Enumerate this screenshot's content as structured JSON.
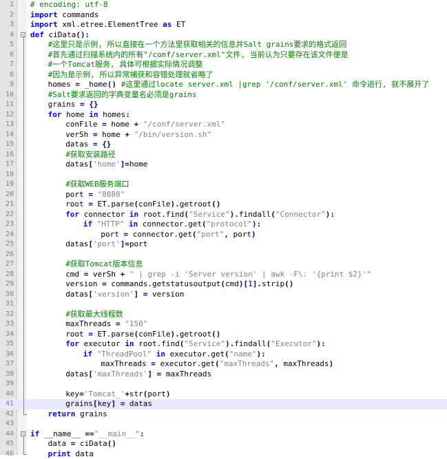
{
  "colors": {
    "keyword": "#0000ff",
    "comment": "#008000",
    "string": "#808080",
    "operator": "#000080",
    "gutter": "#e4e4e4",
    "current_line": "#e8e8ff"
  },
  "lines": [
    {
      "no": "1",
      "indent": 0,
      "tokens": [
        [
          "cm",
          "# encoding: utf-8"
        ]
      ]
    },
    {
      "no": "2",
      "indent": 0,
      "tokens": [
        [
          "kw",
          "import"
        ],
        [
          "nm",
          " commands"
        ]
      ]
    },
    {
      "no": "3",
      "indent": 0,
      "tokens": [
        [
          "kw",
          "import"
        ],
        [
          "nm",
          " xml.etree.ElementTree "
        ],
        [
          "kw",
          "as"
        ],
        [
          "nm",
          " ET"
        ]
      ]
    },
    {
      "no": "4",
      "indent": 0,
      "tokens": [
        [
          "kw",
          "def"
        ],
        [
          "nm",
          " ciData"
        ],
        [
          "op",
          "():"
        ]
      ]
    },
    {
      "no": "5",
      "indent": 1,
      "tokens": [
        [
          "cm",
          "#这里只是示例, 所以直接在一个方法里获取相关的信息并Salt grains要求的格式返回"
        ]
      ]
    },
    {
      "no": "6",
      "indent": 1,
      "tokens": [
        [
          "cm",
          "#首先通过扫描系统内的所有\"/conf/server.xml\"文件, 当前认为只要存在该文件便是"
        ]
      ]
    },
    {
      "no": "7",
      "indent": 1,
      "tokens": [
        [
          "cm",
          "#一个Tomcat服务, 具体可根据实际情况调整"
        ]
      ]
    },
    {
      "no": "8",
      "indent": 1,
      "tokens": [
        [
          "cm",
          "#因为是示例, 所以异常捕获和容错处理就省略了"
        ]
      ]
    },
    {
      "no": "9",
      "indent": 1,
      "tokens": [
        [
          "nm",
          "homes "
        ],
        [
          "op",
          "="
        ],
        [
          "nm",
          " _home"
        ],
        [
          "op",
          "()"
        ],
        [
          "nm",
          " "
        ],
        [
          "cm",
          "#这里通过locate server.xml |grep '/conf/server.xml' 命令进行, 就不展开了"
        ]
      ]
    },
    {
      "no": "10",
      "indent": 1,
      "tokens": [
        [
          "cm",
          "#Salt要求返回的字典变量名必须是grains"
        ]
      ]
    },
    {
      "no": "11",
      "indent": 1,
      "tokens": [
        [
          "nm",
          "grains "
        ],
        [
          "op",
          "="
        ],
        [
          "nm",
          " "
        ],
        [
          "op",
          "{}"
        ]
      ]
    },
    {
      "no": "12",
      "indent": 1,
      "tokens": [
        [
          "kw",
          "for"
        ],
        [
          "nm",
          " home "
        ],
        [
          "kw",
          "in"
        ],
        [
          "nm",
          " homes"
        ],
        [
          "op",
          ":"
        ]
      ]
    },
    {
      "no": "13",
      "indent": 2,
      "tokens": [
        [
          "nm",
          "conFile "
        ],
        [
          "op",
          "="
        ],
        [
          "nm",
          " home "
        ],
        [
          "op",
          "+"
        ],
        [
          "nm",
          " "
        ],
        [
          "st",
          "\"/conf/server.xml\""
        ]
      ]
    },
    {
      "no": "14",
      "indent": 2,
      "tokens": [
        [
          "nm",
          "verSh "
        ],
        [
          "op",
          "="
        ],
        [
          "nm",
          " home "
        ],
        [
          "op",
          "+"
        ],
        [
          "nm",
          " "
        ],
        [
          "st",
          "\"/bin/version.sh\""
        ]
      ]
    },
    {
      "no": "15",
      "indent": 2,
      "tokens": [
        [
          "nm",
          "datas "
        ],
        [
          "op",
          "="
        ],
        [
          "nm",
          " "
        ],
        [
          "op",
          "{}"
        ]
      ]
    },
    {
      "no": "16",
      "indent": 2,
      "tokens": [
        [
          "cm",
          "#获取安装路径"
        ]
      ]
    },
    {
      "no": "17",
      "indent": 2,
      "tokens": [
        [
          "nm",
          "datas"
        ],
        [
          "op",
          "["
        ],
        [
          "st",
          "'home'"
        ],
        [
          "op",
          "]="
        ],
        [
          "nm",
          "home"
        ]
      ]
    },
    {
      "no": "18",
      "indent": 0,
      "tokens": []
    },
    {
      "no": "19",
      "indent": 2,
      "tokens": [
        [
          "cm",
          "#获取WEB服务端口"
        ]
      ]
    },
    {
      "no": "20",
      "indent": 2,
      "tokens": [
        [
          "nm",
          "port "
        ],
        [
          "op",
          "="
        ],
        [
          "nm",
          " "
        ],
        [
          "st",
          "\"8080\""
        ]
      ]
    },
    {
      "no": "21",
      "indent": 2,
      "tokens": [
        [
          "nm",
          "root "
        ],
        [
          "op",
          "="
        ],
        [
          "nm",
          " ET.parse"
        ],
        [
          "op",
          "("
        ],
        [
          "nm",
          "conFile"
        ],
        [
          "op",
          ")."
        ],
        [
          "nm",
          "getroot"
        ],
        [
          "op",
          "()"
        ]
      ]
    },
    {
      "no": "22",
      "indent": 2,
      "tokens": [
        [
          "kw",
          "for"
        ],
        [
          "nm",
          " connector "
        ],
        [
          "kw",
          "in"
        ],
        [
          "nm",
          " root.find"
        ],
        [
          "op",
          "("
        ],
        [
          "st",
          "\"Service\""
        ],
        [
          "op",
          ")."
        ],
        [
          "nm",
          "findall"
        ],
        [
          "op",
          "("
        ],
        [
          "st",
          "\"Connector\""
        ],
        [
          "op",
          "):"
        ]
      ]
    },
    {
      "no": "23",
      "indent": 3,
      "tokens": [
        [
          "kw",
          "if"
        ],
        [
          "nm",
          " "
        ],
        [
          "st",
          "\"HTTP\""
        ],
        [
          "nm",
          " "
        ],
        [
          "kw",
          "in"
        ],
        [
          "nm",
          " connector.get"
        ],
        [
          "op",
          "("
        ],
        [
          "st",
          "\"protocol\""
        ],
        [
          "op",
          "):"
        ]
      ]
    },
    {
      "no": "24",
      "indent": 4,
      "tokens": [
        [
          "nm",
          "port "
        ],
        [
          "op",
          "="
        ],
        [
          "nm",
          " connector.get"
        ],
        [
          "op",
          "("
        ],
        [
          "st",
          "\"port\""
        ],
        [
          "op",
          ","
        ],
        [
          "nm",
          " port"
        ],
        [
          "op",
          ")"
        ]
      ]
    },
    {
      "no": "25",
      "indent": 2,
      "tokens": [
        [
          "nm",
          "datas"
        ],
        [
          "op",
          "["
        ],
        [
          "st",
          "'port'"
        ],
        [
          "op",
          "]="
        ],
        [
          "nm",
          "port"
        ]
      ]
    },
    {
      "no": "26",
      "indent": 0,
      "tokens": []
    },
    {
      "no": "27",
      "indent": 2,
      "tokens": [
        [
          "cm",
          "#获取Tomcat版本信息"
        ]
      ]
    },
    {
      "no": "28",
      "indent": 2,
      "tokens": [
        [
          "nm",
          "cmd "
        ],
        [
          "op",
          "="
        ],
        [
          "nm",
          " verSh "
        ],
        [
          "op",
          "+"
        ],
        [
          "nm",
          " "
        ],
        [
          "st",
          "\" | grep -i 'Server version' | awk -F\\: '{print $2}'\""
        ]
      ]
    },
    {
      "no": "29",
      "indent": 2,
      "tokens": [
        [
          "nm",
          "version "
        ],
        [
          "op",
          "="
        ],
        [
          "nm",
          " commands.getstatusoutput"
        ],
        [
          "op",
          "("
        ],
        [
          "nm",
          "cmd"
        ],
        [
          "op",
          ")["
        ],
        [
          "nm",
          "1"
        ],
        [
          "op",
          "]."
        ],
        [
          "nm",
          "strip"
        ],
        [
          "op",
          "()"
        ]
      ]
    },
    {
      "no": "30",
      "indent": 2,
      "tokens": [
        [
          "nm",
          "datas"
        ],
        [
          "op",
          "["
        ],
        [
          "st",
          "'version'"
        ],
        [
          "op",
          "]"
        ],
        [
          "nm",
          " "
        ],
        [
          "op",
          "="
        ],
        [
          "nm",
          " version"
        ]
      ]
    },
    {
      "no": "31",
      "indent": 0,
      "tokens": []
    },
    {
      "no": "32",
      "indent": 2,
      "tokens": [
        [
          "cm",
          "#获取最大线程数"
        ]
      ]
    },
    {
      "no": "33",
      "indent": 2,
      "tokens": [
        [
          "nm",
          "maxThreads "
        ],
        [
          "op",
          "="
        ],
        [
          "nm",
          " "
        ],
        [
          "st",
          "\"150\""
        ]
      ]
    },
    {
      "no": "34",
      "indent": 2,
      "tokens": [
        [
          "nm",
          "root "
        ],
        [
          "op",
          "="
        ],
        [
          "nm",
          " ET.parse"
        ],
        [
          "op",
          "("
        ],
        [
          "nm",
          "conFile"
        ],
        [
          "op",
          ")."
        ],
        [
          "nm",
          "getroot"
        ],
        [
          "op",
          "()"
        ]
      ]
    },
    {
      "no": "35",
      "indent": 2,
      "tokens": [
        [
          "kw",
          "for"
        ],
        [
          "nm",
          " executor "
        ],
        [
          "kw",
          "in"
        ],
        [
          "nm",
          " root.find"
        ],
        [
          "op",
          "("
        ],
        [
          "st",
          "\"Service\""
        ],
        [
          "op",
          ")."
        ],
        [
          "nm",
          "findall"
        ],
        [
          "op",
          "("
        ],
        [
          "st",
          "\"Executor\""
        ],
        [
          "op",
          "):"
        ]
      ]
    },
    {
      "no": "36",
      "indent": 3,
      "tokens": [
        [
          "kw",
          "if"
        ],
        [
          "nm",
          " "
        ],
        [
          "st",
          "\"ThreadPool\""
        ],
        [
          "nm",
          " "
        ],
        [
          "kw",
          "in"
        ],
        [
          "nm",
          " executor.get"
        ],
        [
          "op",
          "("
        ],
        [
          "st",
          "\"name\""
        ],
        [
          "op",
          "):"
        ]
      ]
    },
    {
      "no": "37",
      "indent": 4,
      "tokens": [
        [
          "nm",
          "maxThreads "
        ],
        [
          "op",
          "="
        ],
        [
          "nm",
          " executor.get"
        ],
        [
          "op",
          "("
        ],
        [
          "st",
          "\"maxThreads\""
        ],
        [
          "op",
          ","
        ],
        [
          "nm",
          " maxThreads"
        ],
        [
          "op",
          ")"
        ]
      ]
    },
    {
      "no": "38",
      "indent": 2,
      "tokens": [
        [
          "nm",
          "datas"
        ],
        [
          "op",
          "["
        ],
        [
          "st",
          "'maxThreads'"
        ],
        [
          "op",
          "]"
        ],
        [
          "nm",
          " "
        ],
        [
          "op",
          "="
        ],
        [
          "nm",
          " maxThreads"
        ]
      ]
    },
    {
      "no": "39",
      "indent": 0,
      "tokens": []
    },
    {
      "no": "40",
      "indent": 2,
      "tokens": [
        [
          "nm",
          "key"
        ],
        [
          "op",
          "="
        ],
        [
          "st",
          "'Tomcat_'"
        ],
        [
          "op",
          "+"
        ],
        [
          "nm",
          "str"
        ],
        [
          "op",
          "("
        ],
        [
          "nm",
          "port"
        ],
        [
          "op",
          ")"
        ]
      ]
    },
    {
      "no": "41",
      "indent": 2,
      "tokens": [
        [
          "nm",
          "grains"
        ],
        [
          "op",
          "["
        ],
        [
          "nm",
          "key"
        ],
        [
          "op",
          "]"
        ],
        [
          "nm",
          " "
        ],
        [
          "op",
          "="
        ],
        [
          "nm",
          " datas"
        ]
      ]
    },
    {
      "no": "42",
      "indent": 1,
      "tokens": [
        [
          "kw",
          "return"
        ],
        [
          "nm",
          " grains"
        ]
      ]
    },
    {
      "no": "43",
      "indent": 0,
      "tokens": []
    },
    {
      "no": "44",
      "indent": 0,
      "tokens": [
        [
          "kw",
          "if"
        ],
        [
          "nm",
          " __name__ "
        ],
        [
          "op",
          "=="
        ],
        [
          "st",
          "\"__main__\""
        ],
        [
          "op",
          ":"
        ]
      ]
    },
    {
      "no": "45",
      "indent": 1,
      "tokens": [
        [
          "nm",
          "data "
        ],
        [
          "op",
          "="
        ],
        [
          "nm",
          " ciData"
        ],
        [
          "op",
          "()"
        ]
      ]
    },
    {
      "no": "46",
      "indent": 1,
      "tokens": [
        [
          "kw",
          "print"
        ],
        [
          "nm",
          " data"
        ]
      ]
    }
  ]
}
